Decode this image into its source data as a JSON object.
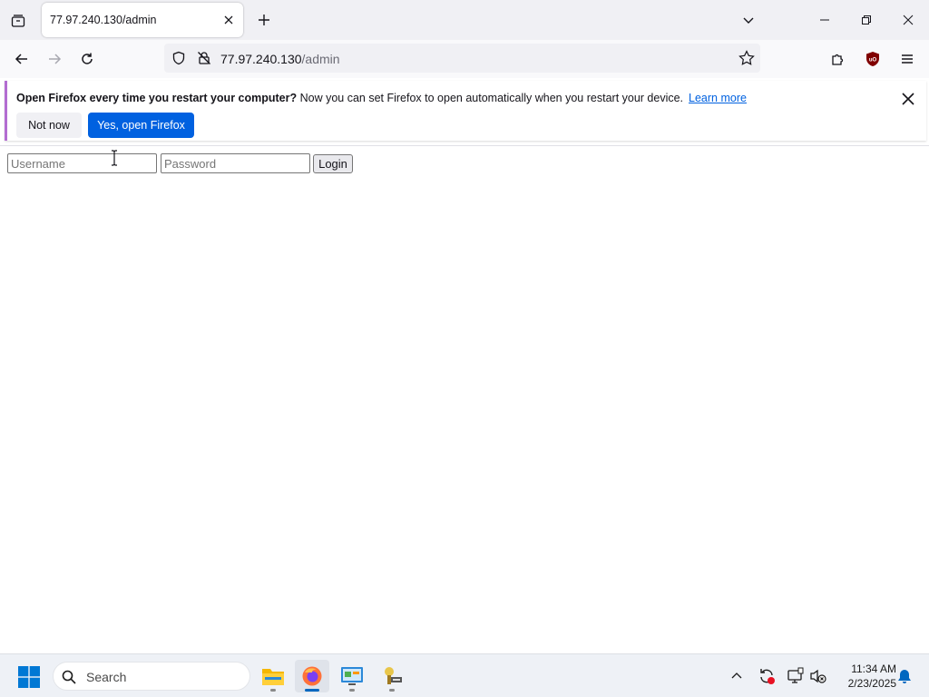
{
  "browser": {
    "tab": {
      "title": "77.97.240.130/admin"
    },
    "url": {
      "host": "77.97.240.130",
      "path": "/admin"
    }
  },
  "notification": {
    "bold_text": "Open Firefox every time you restart your computer?",
    "text": " Now you can set Firefox to open automatically when you restart your device.",
    "link": "Learn more",
    "not_now": "Not now",
    "yes": "Yes, open Firefox"
  },
  "login": {
    "username_placeholder": "Username",
    "password_placeholder": "Password",
    "button": "Login"
  },
  "taskbar": {
    "search_placeholder": "Search",
    "time": "11:34 AM",
    "date": "2/23/2025"
  },
  "colors": {
    "accent_blue": "#0061e0",
    "notification_stripe": "#b36dd1"
  }
}
